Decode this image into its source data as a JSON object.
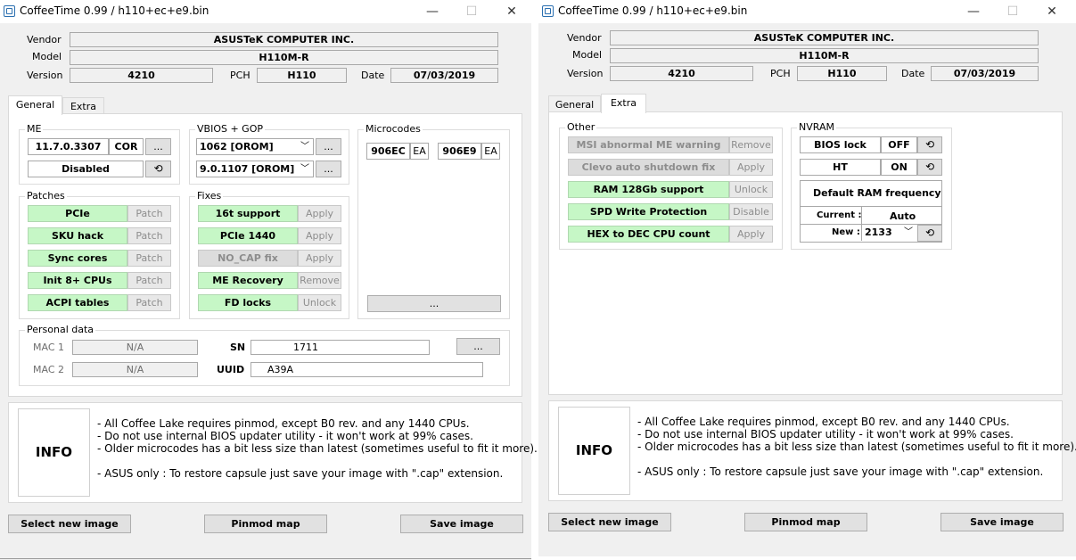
{
  "window": {
    "title": "CoffeeTime 0.99  /  h110+ec+e9.bin",
    "minimize": "—",
    "maximize": "☐",
    "close": "✕"
  },
  "header": {
    "vendor_label": "Vendor",
    "vendor": "ASUSTeK COMPUTER INC.",
    "model_label": "Model",
    "model": "H110M-R",
    "version_label": "Version",
    "version": "4210",
    "pch_label": "PCH",
    "pch": "H110",
    "date_label": "Date",
    "date": "07/03/2019"
  },
  "tabs": [
    "General",
    "Extra"
  ],
  "general": {
    "me": {
      "title": "ME",
      "version": "11.7.0.3307",
      "type": "COR",
      "more": "...",
      "state": "Disabled"
    },
    "vbios": {
      "title": "VBIOS + GOP",
      "vbios": "1062 [OROM]",
      "gop": "9.0.1107 [OROM]",
      "more": "..."
    },
    "microcodes": {
      "title": "Microcodes",
      "items": [
        {
          "id": "906EC",
          "tag": "EA"
        },
        {
          "id": "906E9",
          "tag": "EA"
        }
      ],
      "more": "..."
    },
    "patches": {
      "title": "Patches",
      "items": [
        {
          "name": "PCIe",
          "action": "Patch"
        },
        {
          "name": "SKU hack",
          "action": "Patch"
        },
        {
          "name": "Sync cores",
          "action": "Patch"
        },
        {
          "name": "Init 8+ CPUs",
          "action": "Patch"
        },
        {
          "name": "ACPI tables",
          "action": "Patch"
        }
      ]
    },
    "fixes": {
      "title": "Fixes",
      "items": [
        {
          "name": "16t support",
          "action": "Apply"
        },
        {
          "name": "PCIe 1440",
          "action": "Apply"
        },
        {
          "name": "NO_CAP fix",
          "action": "Apply"
        },
        {
          "name": "ME Recovery",
          "action": "Remove"
        },
        {
          "name": "FD locks",
          "action": "Unlock"
        }
      ]
    },
    "personal": {
      "title": "Personal data",
      "mac1_label": "MAC 1",
      "mac1": "N/A",
      "mac2_label": "MAC 2",
      "mac2": "N/A",
      "sn_label": "SN",
      "sn": "1711",
      "uuid_label": "UUID",
      "uuid": "A39A",
      "more": "..."
    }
  },
  "extra": {
    "other": {
      "title": "Other",
      "items": [
        {
          "name": "MSI abnormal ME warning",
          "action": "Remove"
        },
        {
          "name": "Clevo auto shutdown fix",
          "action": "Apply"
        },
        {
          "name": "RAM 128Gb support",
          "action": "Unlock"
        },
        {
          "name": "SPD Write Protection",
          "action": "Disable"
        },
        {
          "name": "HEX to DEC CPU count",
          "action": "Apply"
        }
      ]
    },
    "nvram": {
      "title": "NVRAM",
      "bios_lock": "BIOS lock",
      "bios_lock_state": "OFF",
      "ht": "HT",
      "ht_state": "ON",
      "ram_freq_title": "Default RAM frequency",
      "current_label": "Current :",
      "current": "Auto",
      "new_label": "New :",
      "new": "2133"
    }
  },
  "info": {
    "label": "INFO",
    "text": "- All Coffee Lake requires pinmod, except B0 rev. and any 1440 CPUs.\n- Do not use internal BIOS updater utility - it won't work at 99% cases.\n- Older microcodes has a bit less size than latest (sometimes useful to fit it more).\n\n- ASUS only : To restore capsule just save your image with \".cap\" extension."
  },
  "footer": {
    "select": "Select new image",
    "pinmod": "Pinmod map",
    "save": "Save image"
  },
  "icons": {
    "refresh": "⟲",
    "dropdown": "﹀"
  }
}
